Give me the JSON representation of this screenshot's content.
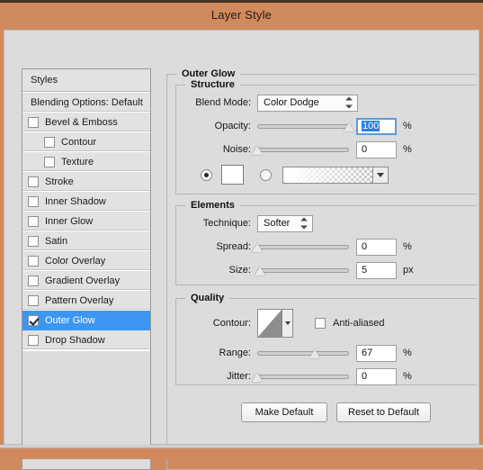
{
  "window": {
    "title": "Layer Style",
    "titlebar_color": "#d08a5e",
    "body_color": "#dcdcdc",
    "selection_color": "#3d97f2"
  },
  "sidebar": {
    "header_label": "Styles",
    "blending_options_label": "Blending Options: Default",
    "items": [
      {
        "label": "Bevel & Emboss",
        "checked": false,
        "indent": false,
        "selected": false
      },
      {
        "label": "Contour",
        "checked": false,
        "indent": true,
        "selected": false
      },
      {
        "label": "Texture",
        "checked": false,
        "indent": true,
        "selected": false
      },
      {
        "label": "Stroke",
        "checked": false,
        "indent": false,
        "selected": false
      },
      {
        "label": "Inner Shadow",
        "checked": false,
        "indent": false,
        "selected": false
      },
      {
        "label": "Inner Glow",
        "checked": false,
        "indent": false,
        "selected": false
      },
      {
        "label": "Satin",
        "checked": false,
        "indent": false,
        "selected": false
      },
      {
        "label": "Color Overlay",
        "checked": false,
        "indent": false,
        "selected": false
      },
      {
        "label": "Gradient Overlay",
        "checked": false,
        "indent": false,
        "selected": false
      },
      {
        "label": "Pattern Overlay",
        "checked": false,
        "indent": false,
        "selected": false
      },
      {
        "label": "Outer Glow",
        "checked": true,
        "indent": false,
        "selected": true
      },
      {
        "label": "Drop Shadow",
        "checked": false,
        "indent": false,
        "selected": false
      }
    ]
  },
  "panel": {
    "title": "Outer Glow",
    "structure": {
      "legend": "Structure",
      "blend_mode": {
        "label": "Blend Mode:",
        "value": "Color Dodge"
      },
      "opacity": {
        "label": "Opacity:",
        "value": "100",
        "unit": "%",
        "slider_percent": 100,
        "focused": true
      },
      "noise": {
        "label": "Noise:",
        "value": "0",
        "unit": "%",
        "slider_percent": 0,
        "focused": false
      },
      "fill_type": {
        "color_radio_selected": true,
        "color_value": "#ffffff",
        "gradient_radio_selected": false,
        "gradient_label": "transparent-gradient-preview"
      }
    },
    "elements": {
      "legend": "Elements",
      "technique": {
        "label": "Technique:",
        "value": "Softer"
      },
      "spread": {
        "label": "Spread:",
        "value": "0",
        "unit": "%",
        "slider_percent": 0
      },
      "size": {
        "label": "Size:",
        "value": "5",
        "unit": "px",
        "slider_percent": 3
      }
    },
    "quality": {
      "legend": "Quality",
      "contour": {
        "label": "Contour:",
        "preview": "linear-contour-thumbnail"
      },
      "anti_aliased": {
        "label": "Anti-aliased",
        "checked": false
      },
      "range": {
        "label": "Range:",
        "value": "67",
        "unit": "%",
        "slider_percent": 63
      },
      "jitter": {
        "label": "Jitter:",
        "value": "0",
        "unit": "%",
        "slider_percent": 0
      }
    },
    "buttons": {
      "make_default": "Make Default",
      "reset_to_default": "Reset to Default"
    }
  }
}
